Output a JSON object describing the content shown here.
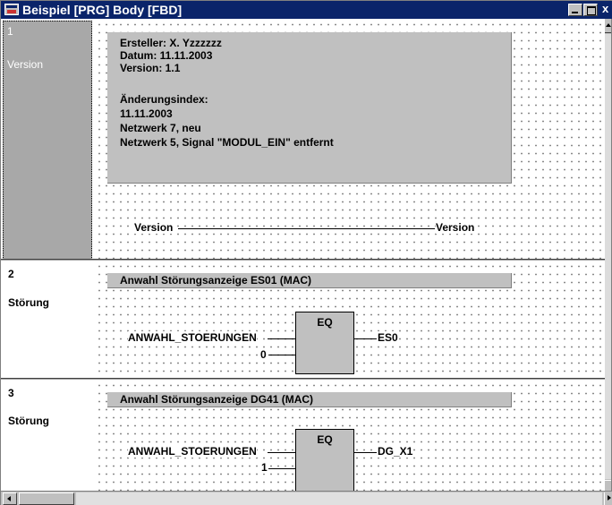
{
  "window": {
    "title": "Beispiel [PRG] Body [FBD]",
    "minimize_label": "_",
    "maximize_label": "□",
    "close_label": "x"
  },
  "networks": [
    {
      "number": "1",
      "label": "Version",
      "selected": true,
      "comment": [
        "Ersteller: X. Yzzzzzz",
        "Datum: 11.11.2003",
        "Version: 1.1",
        "",
        "Änderungsindex:",
        "11.11.2003",
        "Netzwerk 7, neu",
        "Netzwerk 5, Signal \"MODUL_EIN\" entfernt"
      ],
      "input": "Version",
      "output": "Version"
    },
    {
      "number": "2",
      "label": "Störung",
      "comment": "Anwahl Störungsanzeige ES01 (MAC)",
      "block": "EQ",
      "input1": "ANWAHL_STOERUNGEN",
      "input2": "0",
      "output": "ES0"
    },
    {
      "number": "3",
      "label": "Störung",
      "comment": "Anwahl Störungsanzeige DG41 (MAC)",
      "block": "EQ",
      "input1": "ANWAHL_STOERUNGEN",
      "input2": "1",
      "output": "DG_X1"
    }
  ],
  "colors": {
    "titlebar": "#0a246a",
    "selection": "#a8a8a8",
    "comment_bg": "#c0c0c0",
    "block_bg": "#c0c0c0"
  }
}
